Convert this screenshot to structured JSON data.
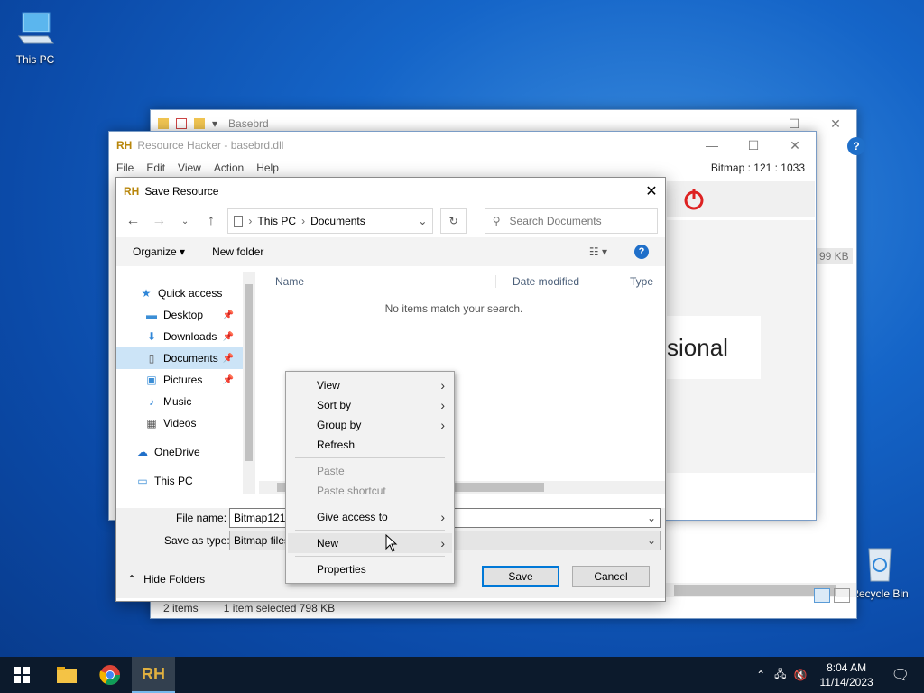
{
  "desktop": {
    "this_pc_label": "This PC",
    "recycle_bin_label": "Recycle Bin"
  },
  "explorer_back": {
    "title": "Basebrd",
    "preview_text": "sional",
    "size_badge": "99 KB",
    "status_items": "2 items",
    "status_selected": "1 item selected  798 KB"
  },
  "resource_hacker": {
    "title": "Resource Hacker - basebrd.dll",
    "menu": [
      "File",
      "Edit",
      "View",
      "Action",
      "Help"
    ],
    "status_right": "Bitmap : 121 : 1033"
  },
  "dialog": {
    "title": "Save Resource",
    "breadcrumb": [
      "This PC",
      "Documents"
    ],
    "search_placeholder": "Search Documents",
    "organize_label": "Organize",
    "new_folder_label": "New folder",
    "tree": [
      {
        "label": "Quick access",
        "icon": "star-icon",
        "level": 0
      },
      {
        "label": "Desktop",
        "icon": "desktop-folder-icon",
        "level": 1,
        "pinned": true
      },
      {
        "label": "Downloads",
        "icon": "download-arrow-icon",
        "level": 1,
        "pinned": true
      },
      {
        "label": "Documents",
        "icon": "document-icon",
        "level": 1,
        "pinned": true,
        "selected": true
      },
      {
        "label": "Pictures",
        "icon": "pictures-icon",
        "level": 1,
        "pinned": true
      },
      {
        "label": "Music",
        "icon": "music-note-icon",
        "level": 1
      },
      {
        "label": "Videos",
        "icon": "video-icon",
        "level": 1
      },
      {
        "label": "OneDrive",
        "icon": "cloud-icon",
        "level": 0
      },
      {
        "label": "This PC",
        "icon": "computer-icon",
        "level": 0
      }
    ],
    "columns": [
      "Name",
      "Date modified",
      "Type"
    ],
    "empty_message": "No items match your search.",
    "file_name_label": "File name:",
    "file_name_value": "Bitmap121",
    "save_as_type_label": "Save as type:",
    "save_as_type_value": "Bitmap files",
    "hide_folders_label": "Hide Folders",
    "save_label": "Save",
    "cancel_label": "Cancel"
  },
  "context_menu": {
    "items": [
      {
        "label": "View",
        "submenu": true
      },
      {
        "label": "Sort by",
        "submenu": true
      },
      {
        "label": "Group by",
        "submenu": true
      },
      {
        "label": "Refresh"
      },
      {
        "separator": true
      },
      {
        "label": "Paste",
        "disabled": true
      },
      {
        "label": "Paste shortcut",
        "disabled": true
      },
      {
        "separator": true
      },
      {
        "label": "Give access to",
        "submenu": true
      },
      {
        "separator": true
      },
      {
        "label": "New",
        "submenu": true,
        "hover": true
      },
      {
        "separator": true
      },
      {
        "label": "Properties"
      }
    ]
  },
  "taskbar": {
    "time": "8:04 AM",
    "date": "11/14/2023",
    "rh_label": "RH"
  },
  "colors": {
    "accent": "#0078d7",
    "rh_red": "#c0392b"
  }
}
